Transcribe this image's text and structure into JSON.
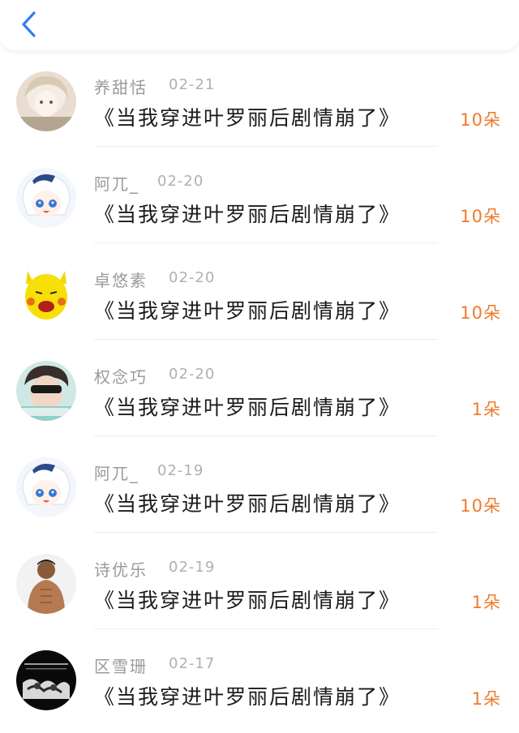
{
  "header": {
    "back_icon": "chevron-left-icon",
    "accent": "#2f7ff0"
  },
  "colors": {
    "count": "#f07a2a",
    "name": "#9a9a9a",
    "title": "#1a1a1a"
  },
  "items": [
    {
      "name": "养甜恬",
      "date": "02-21",
      "title": "《当我穿进叶罗丽后剧情崩了》",
      "count": "10朵"
    },
    {
      "name": "阿兀_",
      "date": "02-20",
      "title": "《当我穿进叶罗丽后剧情崩了》",
      "count": "10朵"
    },
    {
      "name": "卓悠素",
      "date": "02-20",
      "title": "《当我穿进叶罗丽后剧情崩了》",
      "count": "10朵"
    },
    {
      "name": "权念巧",
      "date": "02-20",
      "title": "《当我穿进叶罗丽后剧情崩了》",
      "count": "1朵"
    },
    {
      "name": "阿兀_",
      "date": "02-19",
      "title": "《当我穿进叶罗丽后剧情崩了》",
      "count": "10朵"
    },
    {
      "name": "诗优乐",
      "date": "02-19",
      "title": "《当我穿进叶罗丽后剧情崩了》",
      "count": "1朵"
    },
    {
      "name": "区雪珊",
      "date": "02-17",
      "title": "《当我穿进叶罗丽后剧情崩了》",
      "count": "1朵"
    }
  ]
}
